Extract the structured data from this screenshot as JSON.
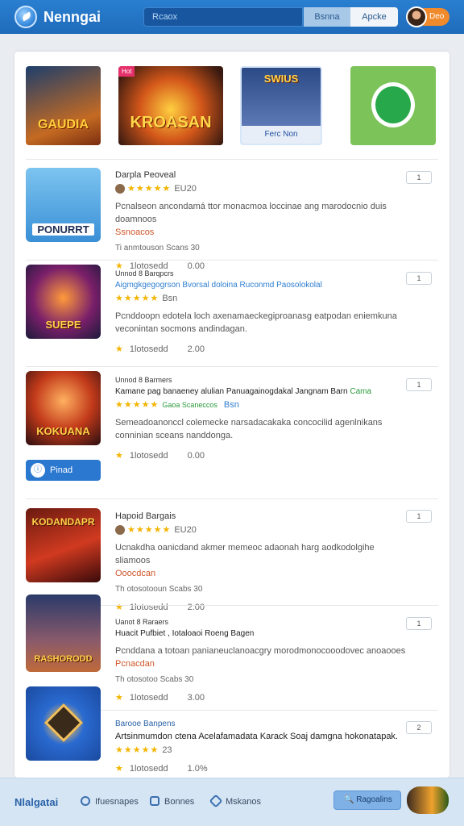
{
  "header": {
    "brand": "Nenngai",
    "search_placeholder": "Rcaox",
    "btn_primary": "Bsnna",
    "btn_secondary": "Apcke",
    "user_pill": "Deo"
  },
  "featured": [
    {
      "title": "GAUDIA",
      "badge": ""
    },
    {
      "title": "KROASAN",
      "badge": "Hot"
    },
    {
      "title": "SWIUS",
      "label": "Ferc Non"
    },
    {
      "title": "",
      "icon": "frog-mascot-icon"
    }
  ],
  "items": [
    {
      "thumb_title": "PONURRT",
      "name": "Darpla Peoveal",
      "sub": "",
      "rating_text": "EU20",
      "desc": "Pcnalseon ancondamá ttor monacmoa loccinae ang marodocnio duis doamnoos",
      "desc2": "Ssnoacos",
      "meta": "Ti anmtouson  Scans    30",
      "stat_label": "1lotosedd",
      "stat_value": "0.00",
      "btn": "1"
    },
    {
      "thumb_title": "SUEPE",
      "name": "Unnod 8 Barqpcrs",
      "sub": "Aigmgkgegogrson Bvorsal doloina Ruconmd Paosolokolal",
      "rating_text": "Bsn",
      "desc": "Pcnddoopn edotela loch axenamaeckegiproanasg eatpodan eniemkuna veconintan socmons andindagan.",
      "desc2": "",
      "meta": "",
      "stat_label": "1lotosedd",
      "stat_value": "2.00",
      "btn": "1"
    },
    {
      "thumb_title": "KOKUANA",
      "name": "Unnod 8 Barmers",
      "sub": "Kamane pag banaeney alulian Panuagainogdakal Jangnam Barn",
      "sub2": "Cama",
      "sub_tag": "Gaoa Scaneccos",
      "rating_text": "Bsn",
      "desc": "Semeadoanonccl colemecke narsadacakaka concocilid agenlnikans conninian sceans nanddonga.",
      "desc2": "",
      "meta": "",
      "stat_label": "1lotosedd",
      "stat_value": "0.00",
      "btn": "1",
      "install_label": "Pinad"
    },
    {
      "thumb_title": "KODANDAPR",
      "name": "Hapoid Bargais",
      "sub": "",
      "rating_text": "EU20",
      "desc": "Ucnakdha oanicdand akmer memeoc adaonah harg aodkodolgihe sliamoos",
      "desc2": "Ooocdcan",
      "meta": "Th otosotooun  Scabs    30",
      "stat_label": "1lotosedd",
      "stat_value": "2.00",
      "btn": "1"
    },
    {
      "thumb_title": "RASHORODD",
      "name": "Uanot 8 Raraers",
      "sub": "Huacit Pufbiet , Iotaloaoi Roeng Bagen",
      "rating_text": "",
      "desc": "Pcnddana a totoan panianeuclanoacgry morodmonocooodovec anoaooes",
      "desc2": "Pcnacdan",
      "meta": "Th otosotoo  Scabs    30",
      "stat_label": "1lotosedd",
      "stat_value": "3.00",
      "btn": "1"
    },
    {
      "thumb_title": "",
      "name": "Barooe Banpens",
      "sub": "Artsinmumdon ctena Acelafamadata Karack Soaj damgna hokonatapak.",
      "rating_text": "23",
      "desc": "",
      "desc2": "",
      "meta": "",
      "stat_label": "1lotosedd",
      "stat_value": "1.0%",
      "btn": "2"
    }
  ],
  "footer": {
    "brand": "Nlalgatai",
    "nav": [
      "Ifuesnapes",
      "Bonnes",
      "Mskanos"
    ],
    "button": "Ragoalins"
  },
  "colors": {
    "header": "#1f6bbb",
    "accent": "#2f7fd0",
    "star": "#f4b400",
    "pill": "#f08a2c"
  }
}
